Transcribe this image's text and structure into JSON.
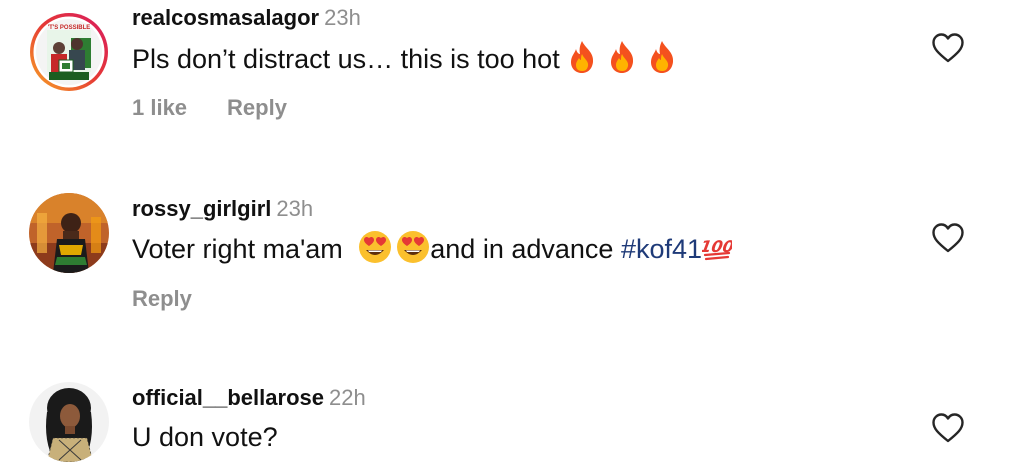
{
  "comments": [
    {
      "username": "realcosmasalagor",
      "time": "23h",
      "text": "Pls don’t distract us… this is too hot",
      "emojis": [
        "fire",
        "fire",
        "fire"
      ],
      "likes": "1 like",
      "reply": "Reply",
      "avatar_text": "'T'S POSSIBLE"
    },
    {
      "username": "rossy_girlgirl",
      "time": "23h",
      "text_before": "Voter right ma'am",
      "emojis": [
        "heart-eyes",
        "heart-eyes"
      ],
      "text_after": "and in advance",
      "hashtag": "#kof41",
      "trailing_emoji": "hundred-points",
      "reply": "Reply"
    },
    {
      "username": "official__bellarose",
      "time": "22h",
      "text": "U don vote?"
    }
  ],
  "icons": {
    "like": "heart-outline-icon"
  },
  "colors": {
    "text": "#111111",
    "muted": "#8e8e8e",
    "hashtag": "#1e3a78",
    "story_ring_start": "#f9a825",
    "story_ring_end": "#d81b60"
  }
}
